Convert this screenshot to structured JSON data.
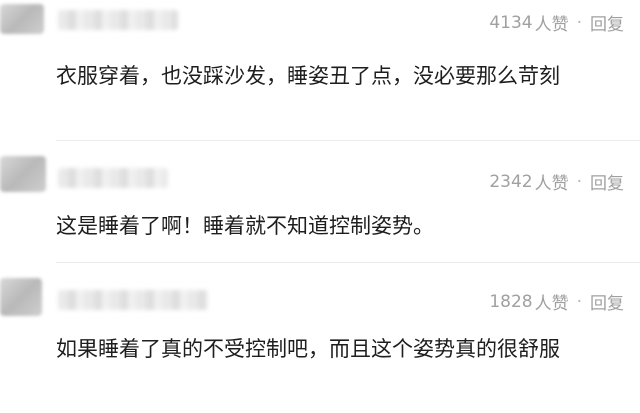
{
  "comments": [
    {
      "likes": "4134",
      "likes_unit": "人赞",
      "separator": "·",
      "reply_label": "回复",
      "text": "衣服穿着，也没踩沙发，睡姿丑了点，没必要那么苛刻"
    },
    {
      "likes": "2342",
      "likes_unit": "人赞",
      "separator": "·",
      "reply_label": "回复",
      "text": "这是睡着了啊！睡着就不知道控制姿势。"
    },
    {
      "likes": "1828",
      "likes_unit": "人赞",
      "separator": "·",
      "reply_label": "回复",
      "text": "如果睡着了真的不受控制吧，而且这个姿势真的很舒服"
    }
  ]
}
